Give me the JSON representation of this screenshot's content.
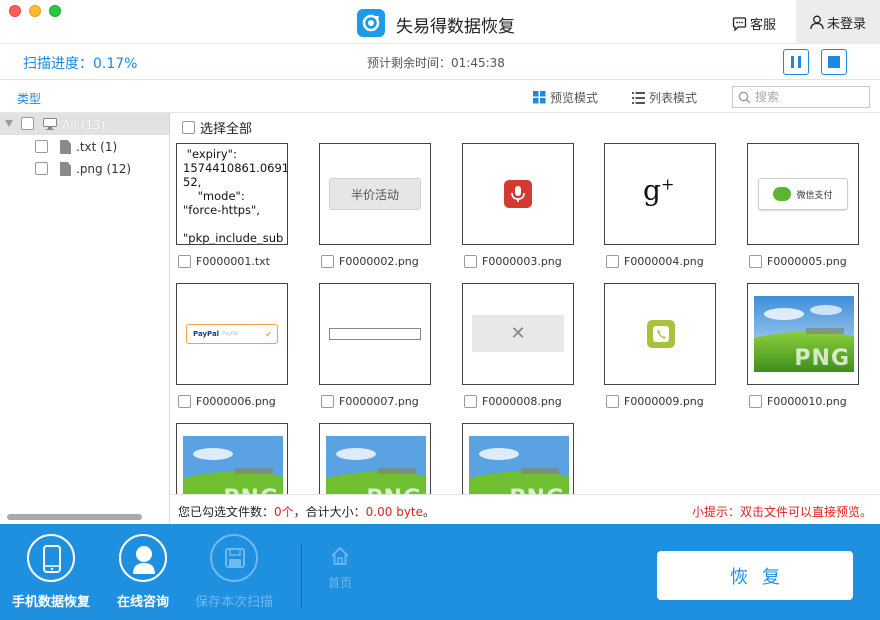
{
  "window": {
    "app_title": "失易得数据恢复",
    "support_label": "客服",
    "login_label": "未登录"
  },
  "progress": {
    "scan_label": "扫描进度：",
    "scan_value": "0.17%",
    "remaining_label": "预计剩余时间：",
    "remaining_value": "01:45:38"
  },
  "header": {
    "type_label": "类型",
    "preview_mode": "预览模式",
    "list_mode": "列表模式",
    "search_placeholder": "搜索"
  },
  "sidebar": {
    "all_label": "All (13)",
    "items": [
      {
        "label": ".txt (1)"
      },
      {
        "label": ".png (12)"
      }
    ]
  },
  "main": {
    "select_all": "选择全部",
    "txt_preview": " \"expiry\":\n1574410861.0691\n52,\n    \"mode\":\n\"force-https\",\n\n\"pkp_include_sub",
    "banhua_text": "半价活动",
    "wechat_pay_text": "微信支付",
    "paypal_text": "PayPal",
    "paypal_sub": "PayPal",
    "png_text": "PNG",
    "files": [
      {
        "name": "F0000001.txt"
      },
      {
        "name": "F0000002.png"
      },
      {
        "name": "F0000003.png"
      },
      {
        "name": "F0000004.png"
      },
      {
        "name": "F0000005.png"
      },
      {
        "name": "F0000006.png"
      },
      {
        "name": "F0000007.png"
      },
      {
        "name": "F0000008.png"
      },
      {
        "name": "F0000009.png"
      },
      {
        "name": "F0000010.png"
      }
    ]
  },
  "status": {
    "selected_prefix": "您已勾选文件数：",
    "selected_count": "0个",
    "size_prefix": "，合计大小：",
    "size_value": "0.00 byte",
    "size_suffix": "。",
    "tip": "小提示：双击文件可以直接预览。"
  },
  "bottom": {
    "phone_recovery": "手机数据恢复",
    "online_consult": "在线咨询",
    "save_scan": "保存本次扫描",
    "home": "首页",
    "restore": "恢复"
  },
  "colors": {
    "accent": "#1e88e5",
    "bottom_bar": "#1f8fe0",
    "warning": "#e02020"
  }
}
